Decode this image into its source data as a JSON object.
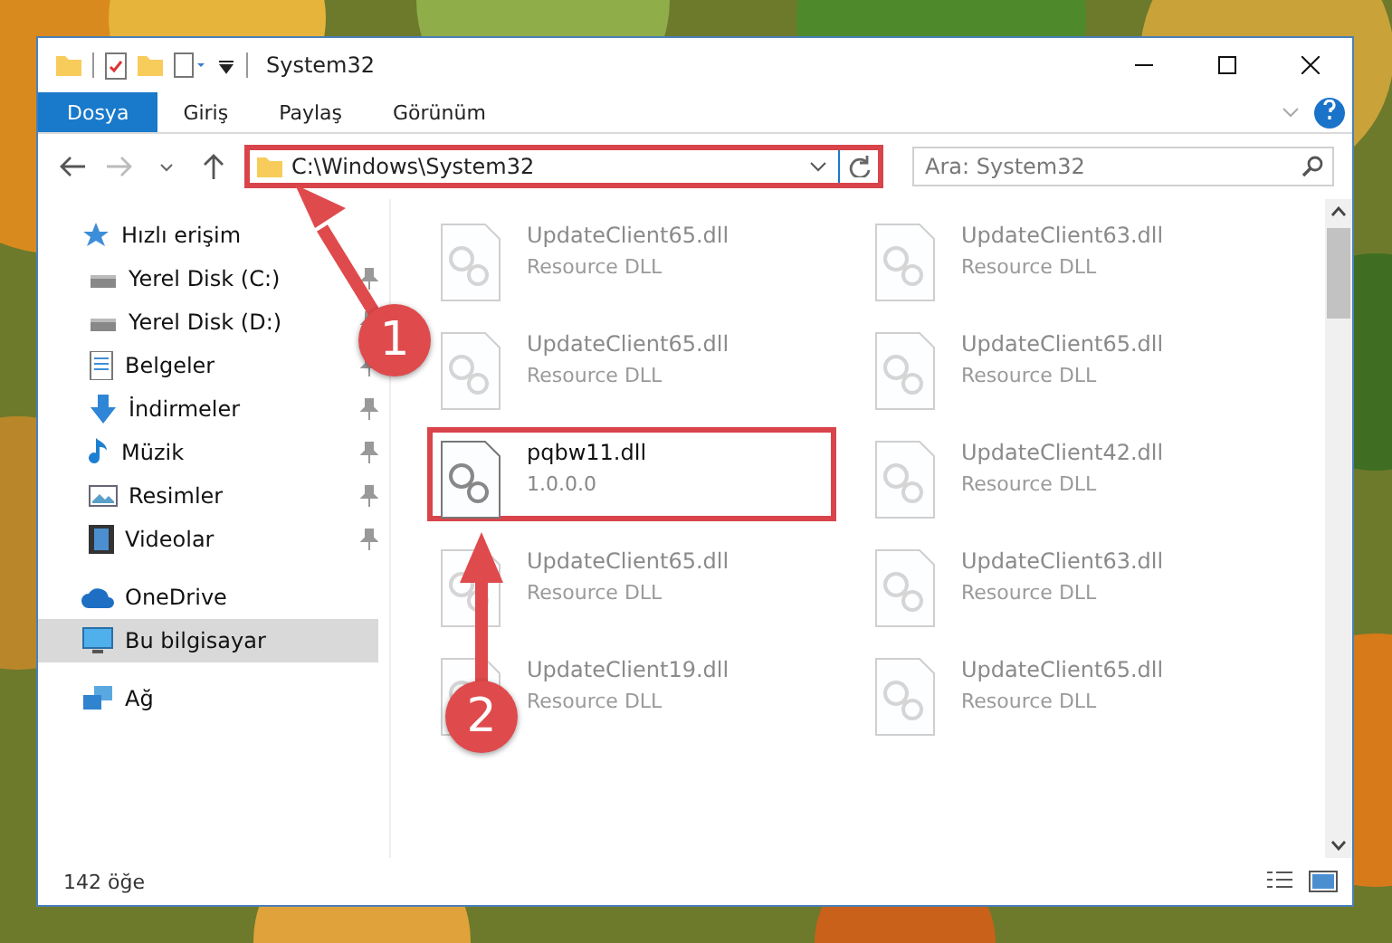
{
  "window": {
    "title": "System32"
  },
  "ribbon_tabs": [
    {
      "label": "Dosya",
      "selected": true
    },
    {
      "label": "Giriş",
      "selected": false
    },
    {
      "label": "Paylaş",
      "selected": false
    },
    {
      "label": "Görünüm",
      "selected": false
    }
  ],
  "address_bar": {
    "path": "C:\\Windows\\System32",
    "highlighted": true
  },
  "search": {
    "placeholder": "Ara: System32"
  },
  "sidebar": {
    "items": [
      {
        "label": "Hızlı erişim",
        "kind": "star",
        "selected": false,
        "children": [
          {
            "label": "Yerel Disk (C:)",
            "kind": "drive",
            "selected": false
          },
          {
            "label": "Yerel Disk (D:)",
            "kind": "drive",
            "selected": false
          },
          {
            "label": "Belgeler",
            "kind": "documents",
            "selected": false
          },
          {
            "label": "İndirmeler",
            "kind": "downloads",
            "selected": false
          },
          {
            "label": "Müzik",
            "kind": "music",
            "selected": false
          },
          {
            "label": "Resimler",
            "kind": "pictures",
            "selected": false
          },
          {
            "label": "Videolar",
            "kind": "videos",
            "selected": false
          }
        ]
      },
      {
        "label": "OneDrive",
        "kind": "cloud",
        "selected": false
      },
      {
        "label": "Bu bilgisayar",
        "kind": "computer",
        "selected": true
      },
      {
        "label": "Ağ",
        "kind": "network",
        "selected": false
      }
    ]
  },
  "files": [
    {
      "name": "UpdateClient65.dll",
      "detail": "Resource DLL",
      "highlighted": false
    },
    {
      "name": "UpdateClient63.dll",
      "detail": "Resource DLL",
      "highlighted": false
    },
    {
      "name": "UpdateClient65.dll",
      "detail": "Resource DLL",
      "highlighted": false
    },
    {
      "name": "UpdateClient65.dll",
      "detail": "Resource DLL",
      "highlighted": false
    },
    {
      "name": "pqbw11.dll",
      "detail": "1.0.0.0",
      "highlighted": true
    },
    {
      "name": "UpdateClient42.dll",
      "detail": "Resource DLL",
      "highlighted": false
    },
    {
      "name": "UpdateClient65.dll",
      "detail": "Resource DLL",
      "highlighted": false
    },
    {
      "name": "UpdateClient63.dll",
      "detail": "Resource DLL",
      "highlighted": false
    },
    {
      "name": "UpdateClient19.dll",
      "detail": "Resource DLL",
      "highlighted": false
    },
    {
      "name": "UpdateClient65.dll",
      "detail": "Resource DLL",
      "highlighted": false
    }
  ],
  "status_bar": {
    "count": "142 öğe"
  },
  "annotations": [
    {
      "number": "1"
    },
    {
      "number": "2"
    }
  ]
}
